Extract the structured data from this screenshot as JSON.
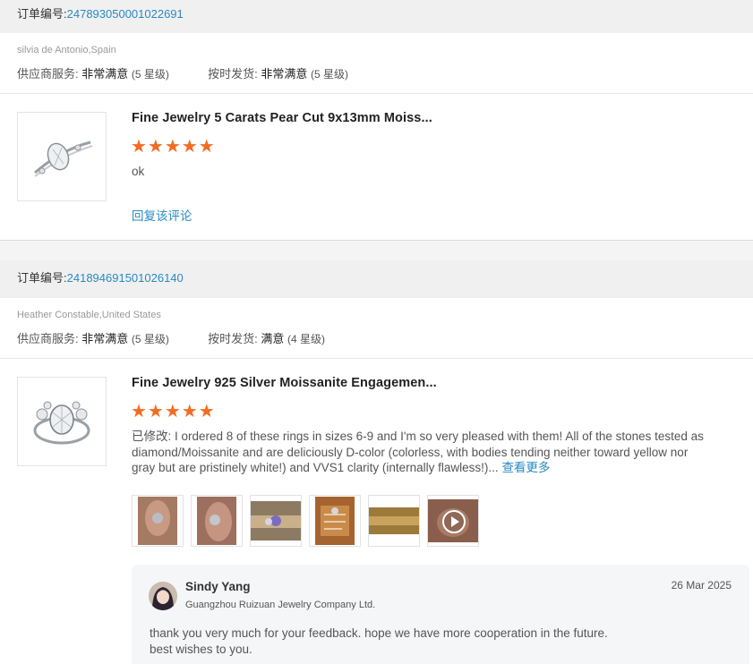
{
  "reviews": [
    {
      "order_label": "订单编号:",
      "order_number": "247893050001022691",
      "buyer": "silvia de Antonio,Spain",
      "supplier_service_label": "供应商服务:",
      "supplier_service_value": "非常满意",
      "supplier_service_stars": "(5 星级)",
      "on_time_label": "按时发货:",
      "on_time_value": "非常满意",
      "on_time_stars": "(5 星级)",
      "product_title": "Fine Jewelry 5 Carats Pear Cut 9x13mm Moiss...",
      "rating": 5,
      "stars_text": "★★★★★",
      "comment": "ok",
      "reply_link": "回复该评论"
    },
    {
      "order_label": "订单编号:",
      "order_number": "241894691501026140",
      "buyer": "Heather Constable,United States",
      "supplier_service_label": "供应商服务:",
      "supplier_service_value": "非常满意",
      "supplier_service_stars": "(5 星级)",
      "on_time_label": "按时发货:",
      "on_time_value": "满意",
      "on_time_stars": "(4 星级)",
      "product_title": "Fine Jewelry 925 Silver Moissanite Engagemen...",
      "rating": 5,
      "stars_text": "★★★★★",
      "comment_prefix": "已修改:",
      "comment": " I ordered 8 of these rings in sizes 6-9 and I'm so very pleased with them! All of the stones tested as diamond/Moissanite and are deliciously D-color (colorless, with bodies tending neither toward yellow nor gray but are pristinely white!) and VVS1 clarity (internally flawless!)...",
      "see_more": "查看更多",
      "photos_count": 6,
      "reply": {
        "name": "Sindy Yang",
        "company": "Guangzhou Ruizuan Jewelry Company Ltd.",
        "date": "26 Mar 2025",
        "text_line1": "thank you very much for your feedback. hope we have more cooperation in the future.",
        "text_line2": "best wishes to you."
      }
    }
  ],
  "colors": {
    "link": "#2a8ac2",
    "star": "#f26b21",
    "header_bg": "#f0f0f0"
  },
  "icons": [
    "ring-product-image",
    "play-video-icon",
    "avatar"
  ]
}
